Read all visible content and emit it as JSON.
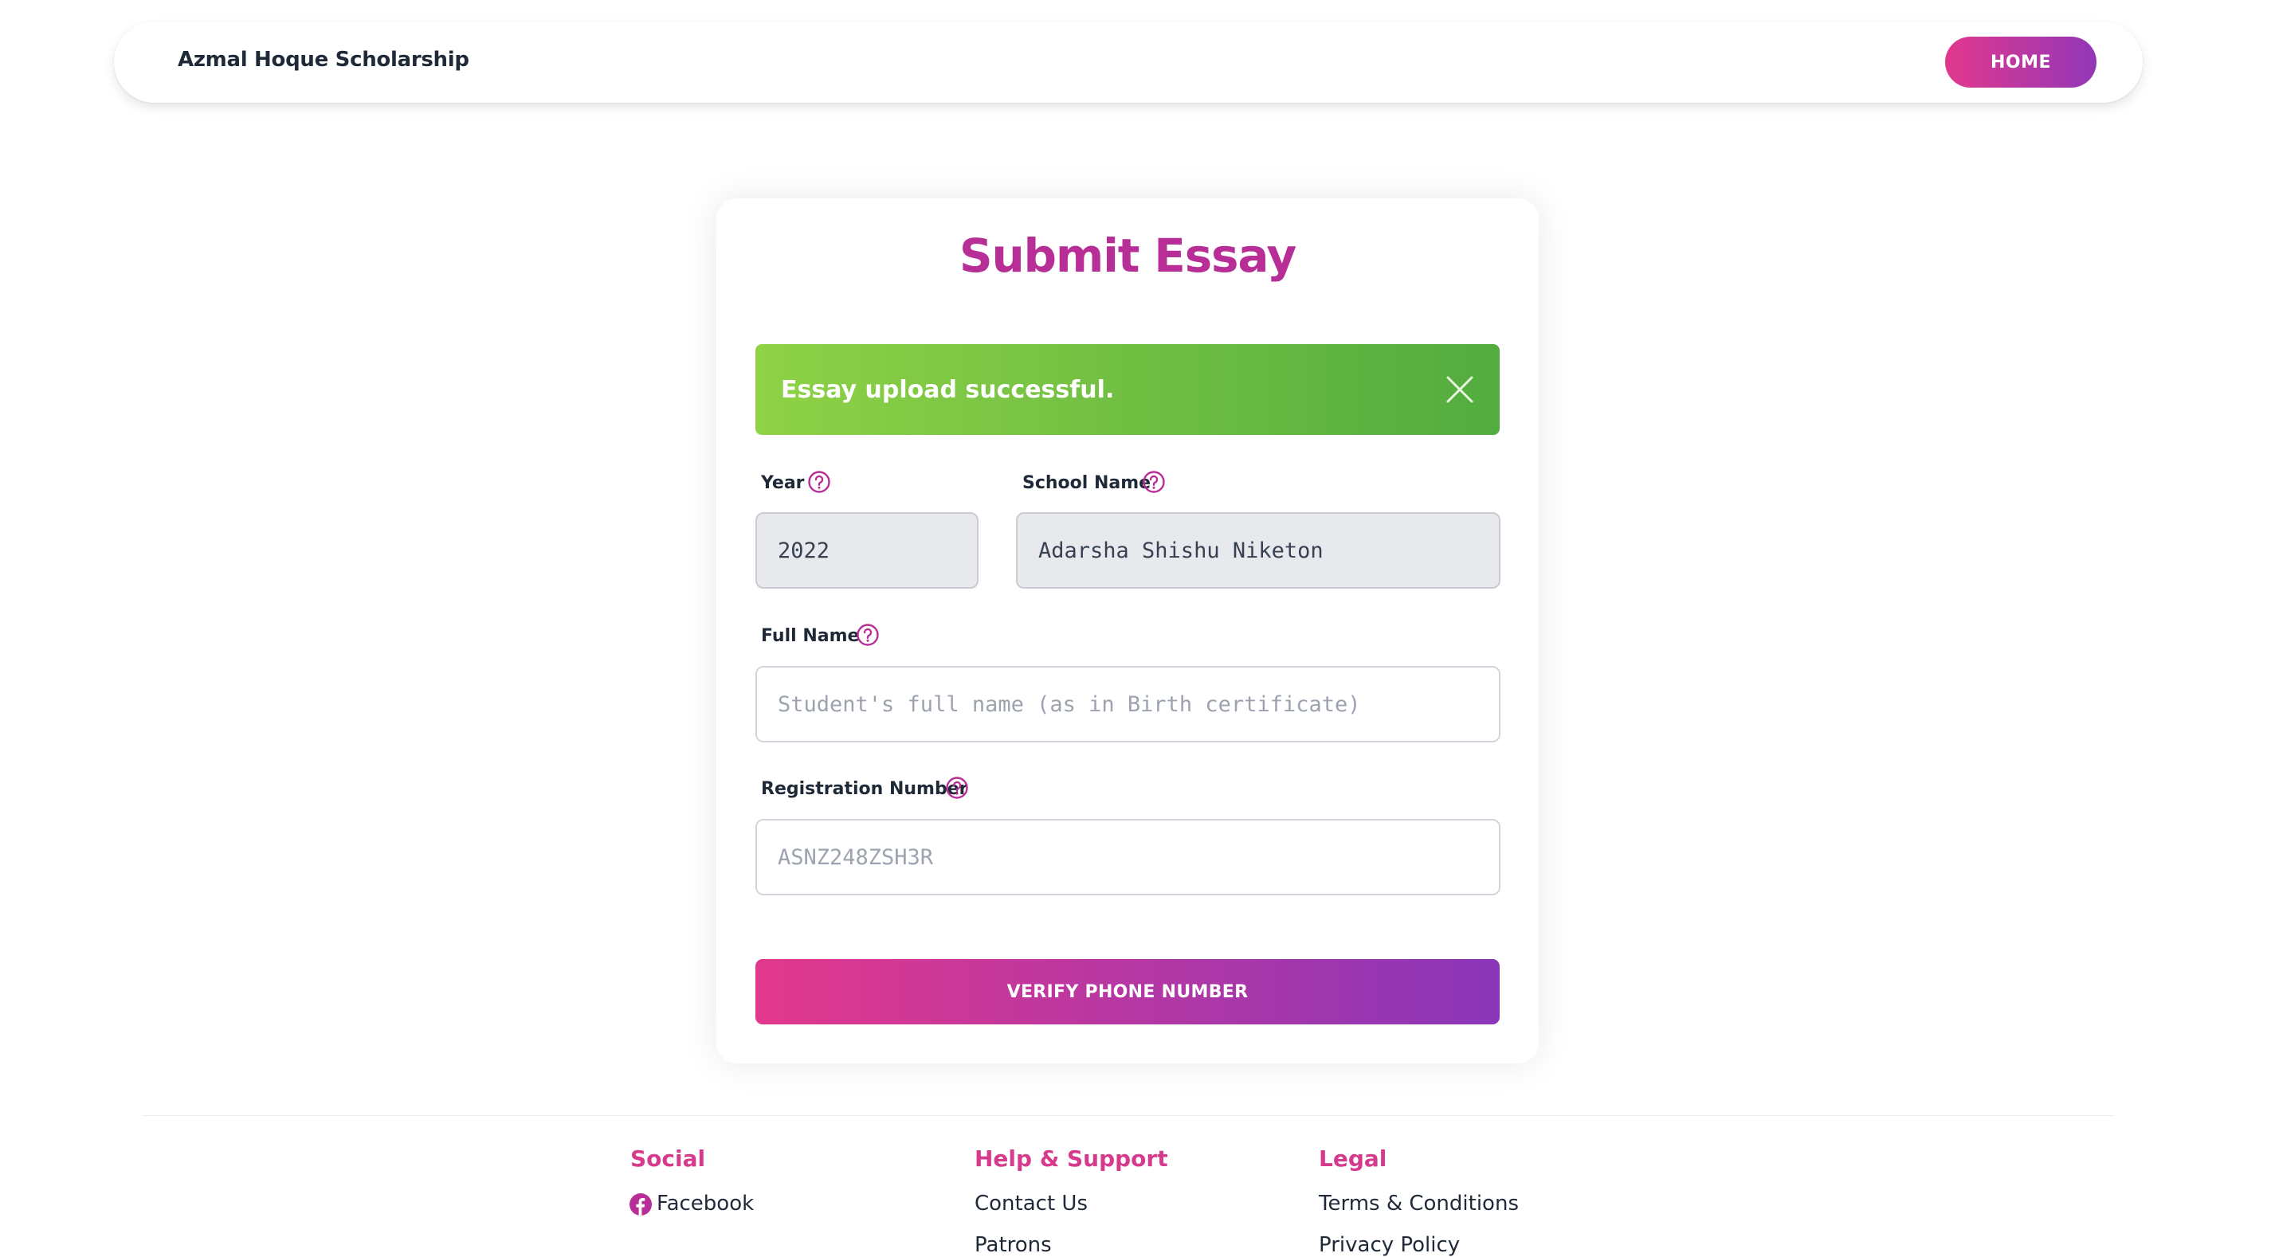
{
  "navbar": {
    "brand": "Azmal Hoque Scholarship",
    "home_label": "HOME"
  },
  "form": {
    "title": "Submit Essay",
    "alert_message": "Essay upload successful.",
    "year": {
      "label": "Year",
      "value": "2022"
    },
    "school": {
      "label": "School Name",
      "value": "Adarsha Shishu Niketon"
    },
    "full_name": {
      "label": "Full Name",
      "value": "",
      "placeholder": "Student's full name (as in Birth certificate)"
    },
    "registration": {
      "label": "Registration Number",
      "value": "",
      "placeholder": "ASNZ248ZSH3R"
    },
    "submit_label": "VERIFY PHONE NUMBER"
  },
  "footer": {
    "social": {
      "heading": "Social",
      "links": [
        "Facebook"
      ]
    },
    "help": {
      "heading": "Help & Support",
      "links": [
        "Contact Us",
        "Patrons"
      ]
    },
    "legal": {
      "heading": "Legal",
      "links": [
        "Terms & Conditions",
        "Privacy Policy"
      ]
    }
  },
  "colors": {
    "accent": "#b72e97",
    "gradient_start": "#e2388c",
    "gradient_end": "#9337b8",
    "success_start": "#8fd246",
    "success_end": "#52ac3f"
  },
  "icons": [
    "help-circle-icon",
    "close-icon",
    "facebook-icon"
  ]
}
